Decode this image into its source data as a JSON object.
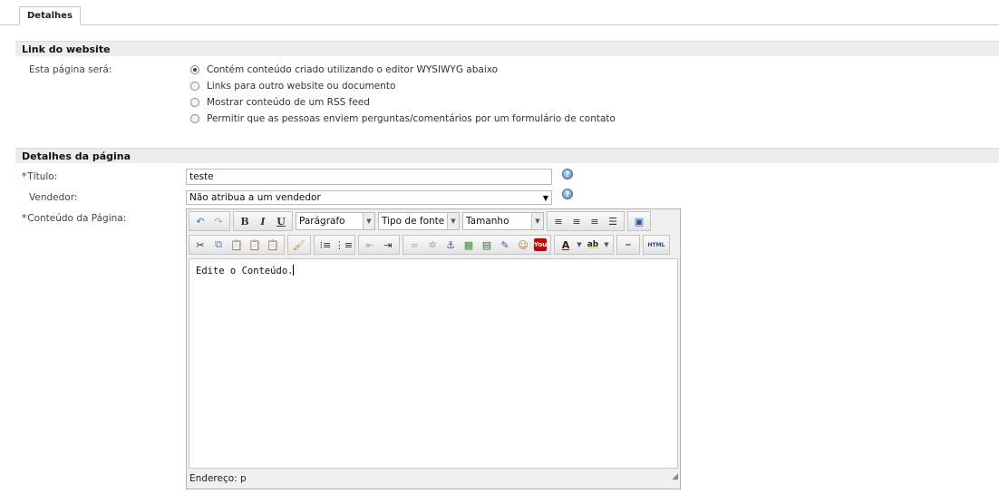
{
  "tabs": [
    {
      "label": "Detalhes"
    }
  ],
  "link_section": {
    "title": "Link do website",
    "field_label": "Esta página será:",
    "options": [
      {
        "label": "Contém conteúdo criado utilizando o editor WYSIWYG abaixo",
        "checked": true
      },
      {
        "label": "Links para outro website ou documento",
        "checked": false
      },
      {
        "label": "Mostrar conteúdo de um RSS feed",
        "checked": false
      },
      {
        "label": "Permitir que as pessoas enviem perguntas/comentários por um formulário de contato",
        "checked": false
      }
    ]
  },
  "page_section": {
    "title": "Detalhes da página",
    "title_label": "Título:",
    "title_value": "teste",
    "vendor_label": "Vendedor:",
    "vendor_value": "Não atribua a um vendedor",
    "content_label": "Conteúdo da Página:"
  },
  "editor": {
    "format_dropdown": "Parágrafo",
    "font_dropdown": "Tipo de fonte",
    "size_dropdown": "Tamanho",
    "html_button": "HTML",
    "youtube_button": "You",
    "body_text": "Edite o Conteúdo.",
    "status": "Endereço: p"
  }
}
